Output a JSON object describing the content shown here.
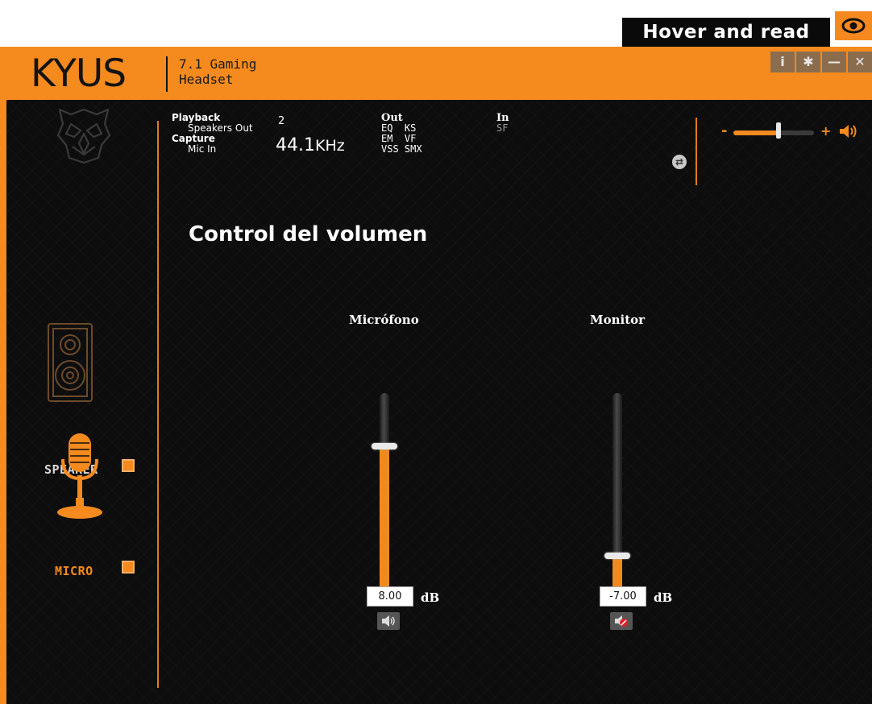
{
  "hover": {
    "label": "Hover and read",
    "icon": "eye-icon"
  },
  "app": {
    "logo": "KYUS",
    "subtitle_line1": "7.1 Gaming",
    "subtitle_line2": "Headset",
    "window_controls": [
      {
        "icon": "info-icon",
        "glyph": "i"
      },
      {
        "icon": "gear-icon",
        "glyph": "✱"
      },
      {
        "icon": "minimize-icon",
        "glyph": "—"
      },
      {
        "icon": "close-icon",
        "glyph": "✕"
      }
    ]
  },
  "status": {
    "playback_label": "Playback",
    "playback_value": "Speakers Out",
    "capture_label": "Capture",
    "capture_value": "Mic In",
    "channels": "2",
    "frequency": "44.1",
    "frequency_unit": "KHz",
    "out_label": "Out",
    "out_row1": "EQ  KS",
    "out_row2": "EM  VF",
    "out_row3": "VSS SMX",
    "in_label": "In",
    "in_row1": "SF"
  },
  "master": {
    "minus": "-",
    "plus": "+",
    "level": 0.55,
    "icon": "speaker-icon"
  },
  "page": {
    "title": "Control del volumen"
  },
  "devices": [
    {
      "label": "SPEAKER",
      "icon": "speaker-cabinet-icon",
      "checked": true
    },
    {
      "label": "MICRO",
      "icon": "microphone-icon",
      "checked": true
    }
  ],
  "sliders": {
    "mic": {
      "title": "Micrófono",
      "value": "8.00",
      "unit": "dB",
      "level": 0.74,
      "muted": false
    },
    "monitor": {
      "title": "Monitor",
      "value": "-7.00",
      "unit": "dB",
      "level": 0.2,
      "muted": true
    }
  },
  "colors": {
    "accent": "#f58a1f",
    "background": "#0d0d0d"
  }
}
